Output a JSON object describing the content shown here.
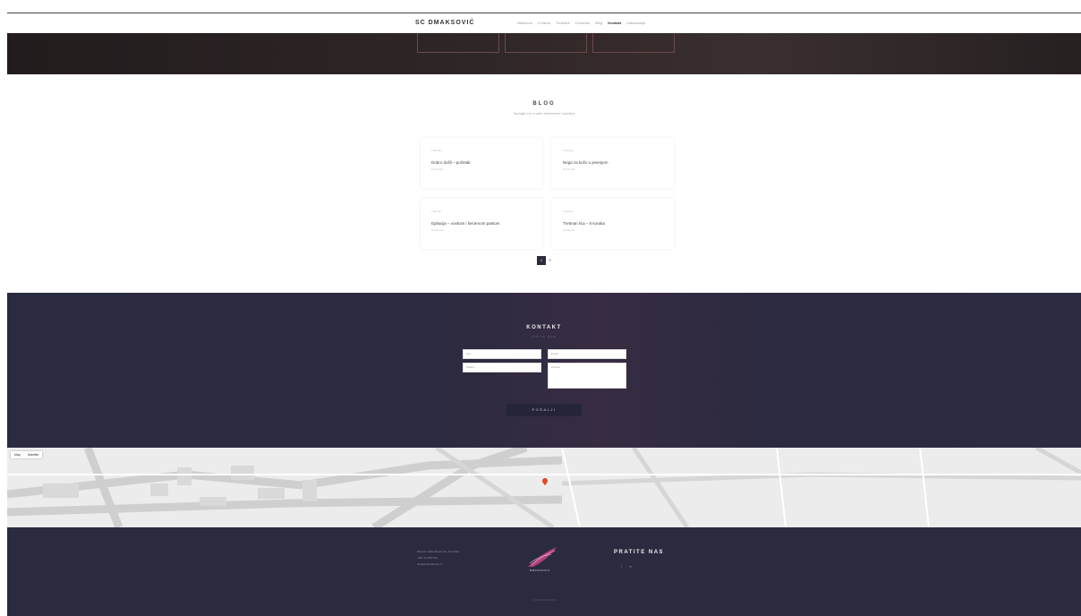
{
  "nav": {
    "logo": "SC DMAKSOVIĆ",
    "items": [
      "Naslovna",
      "O nama",
      "Tretmani",
      "Cenovnik",
      "Blog",
      "Kontakt",
      "Zakazivanje"
    ],
    "active_index": 5
  },
  "blog": {
    "title": "BLOG",
    "subtitle": "Saznajte sve o našim tretmanima i savetima",
    "posts": [
      {
        "category": "Tretmani",
        "title": "Dobro došli – početak",
        "more": "Pročitaj više"
      },
      {
        "category": "Tretmani",
        "title": "Nega za kožu u jesenjem",
        "more": "Pročitaj više"
      },
      {
        "category": "Tretmani",
        "title": "Epilacija – voskom i šećernom pastom",
        "more": "Pročitaj više"
      },
      {
        "category": "Tretmani",
        "title": "Tretman lica – 5 koraka",
        "more": "Pročitaj više"
      }
    ],
    "pagination": {
      "current": "1",
      "next": "»"
    }
  },
  "contact": {
    "title": "KONTAKT",
    "subtitle": "PIŠITE NAM",
    "name_placeholder": "Ime",
    "email_placeholder": "Email",
    "phone_placeholder": "Telefon",
    "message_placeholder": "Poruka",
    "send_label": "POŠALJI"
  },
  "map": {
    "tab_map": "Map",
    "tab_satellite": "Satellite"
  },
  "footer": {
    "address": "Bulevar oslobođenja 123, Novi Sad",
    "phone": "+381 21 000 000",
    "email": "info@scdmaksovic.rs",
    "logo_text": "DMAKSOVIĆ",
    "follow_title": "PRATITE NAS",
    "social": [
      "f",
      "in"
    ],
    "copyright": "© 2019 DMAKSOVIĆ"
  },
  "colors": {
    "dark_navy": "#2b2b40",
    "hero_dark": "#2e2526",
    "map_pin": "#e04a2a"
  }
}
